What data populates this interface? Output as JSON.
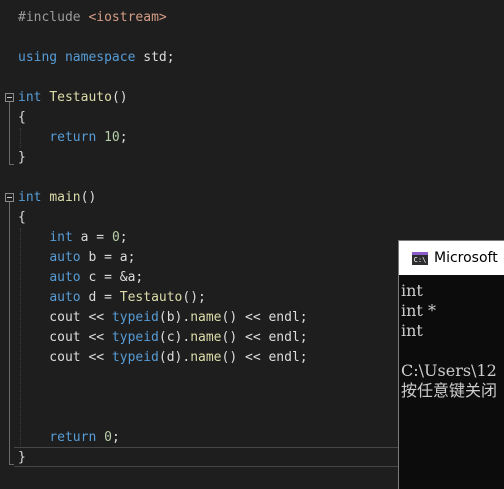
{
  "editor": {
    "lines": [
      {
        "id": "include",
        "parts": [
          [
            "kw-inc",
            "#include "
          ],
          [
            "str",
            "<iostream>"
          ]
        ]
      },
      {
        "id": "blank1",
        "parts": []
      },
      {
        "id": "using",
        "parts": [
          [
            "kw-blue",
            "using"
          ],
          [
            "ident",
            " "
          ],
          [
            "kw-blue",
            "namespace"
          ],
          [
            "ident",
            " std;"
          ]
        ]
      },
      {
        "id": "blank2",
        "parts": []
      },
      {
        "id": "testauto-decl",
        "parts": [
          [
            "kw-blue",
            "int"
          ],
          [
            "ident",
            " "
          ],
          [
            "func",
            "Testauto"
          ],
          [
            "ident",
            "()"
          ]
        ]
      },
      {
        "id": "testauto-open",
        "parts": [
          [
            "ident",
            "{"
          ]
        ]
      },
      {
        "id": "return10",
        "parts": [
          [
            "ident",
            "    "
          ],
          [
            "kw-blue",
            "return"
          ],
          [
            "ident",
            " "
          ],
          [
            "num",
            "10"
          ],
          [
            "ident",
            ";"
          ]
        ]
      },
      {
        "id": "testauto-close",
        "parts": [
          [
            "ident",
            "}"
          ]
        ]
      },
      {
        "id": "blank3",
        "parts": []
      },
      {
        "id": "main-decl",
        "parts": [
          [
            "kw-blue",
            "int"
          ],
          [
            "ident",
            " "
          ],
          [
            "func",
            "main"
          ],
          [
            "ident",
            "()"
          ]
        ]
      },
      {
        "id": "main-open",
        "parts": [
          [
            "ident",
            "{"
          ]
        ]
      },
      {
        "id": "int-a",
        "parts": [
          [
            "ident",
            "    "
          ],
          [
            "kw-blue",
            "int"
          ],
          [
            "ident",
            " a = "
          ],
          [
            "num",
            "0"
          ],
          [
            "ident",
            ";"
          ]
        ]
      },
      {
        "id": "auto-b",
        "parts": [
          [
            "ident",
            "    "
          ],
          [
            "kw-blue",
            "auto"
          ],
          [
            "ident",
            " b = a;"
          ]
        ]
      },
      {
        "id": "auto-c",
        "parts": [
          [
            "ident",
            "    "
          ],
          [
            "kw-blue",
            "auto"
          ],
          [
            "ident",
            " c = &a;"
          ]
        ]
      },
      {
        "id": "auto-d",
        "parts": [
          [
            "ident",
            "    "
          ],
          [
            "kw-blue",
            "auto"
          ],
          [
            "ident",
            " d = "
          ],
          [
            "func",
            "Testauto"
          ],
          [
            "ident",
            "();"
          ]
        ]
      },
      {
        "id": "cout-b",
        "parts": [
          [
            "ident",
            "    cout << "
          ],
          [
            "kw-blue",
            "typeid"
          ],
          [
            "ident",
            "(b)."
          ],
          [
            "func",
            "name"
          ],
          [
            "ident",
            "() << endl;"
          ]
        ]
      },
      {
        "id": "cout-c",
        "parts": [
          [
            "ident",
            "    cout << "
          ],
          [
            "kw-blue",
            "typeid"
          ],
          [
            "ident",
            "(c)."
          ],
          [
            "func",
            "name"
          ],
          [
            "ident",
            "() << endl;"
          ]
        ]
      },
      {
        "id": "cout-d",
        "parts": [
          [
            "ident",
            "    cout << "
          ],
          [
            "kw-blue",
            "typeid"
          ],
          [
            "ident",
            "(d)."
          ],
          [
            "func",
            "name"
          ],
          [
            "ident",
            "() << endl;"
          ]
        ]
      },
      {
        "id": "blank4",
        "parts": []
      },
      {
        "id": "blank5",
        "parts": []
      },
      {
        "id": "blank6",
        "parts": []
      },
      {
        "id": "return0",
        "parts": [
          [
            "ident",
            "    "
          ],
          [
            "kw-blue",
            "return"
          ],
          [
            "ident",
            " "
          ],
          [
            "num",
            "0"
          ],
          [
            "ident",
            ";"
          ]
        ]
      },
      {
        "id": "main-close",
        "parts": [
          [
            "ident",
            "}"
          ]
        ]
      }
    ]
  },
  "console": {
    "title": "Microsoft",
    "icon_label": "C:\\",
    "icon": "console-app-icon",
    "output": [
      "int",
      "int *",
      "int",
      "",
      "C:\\Users\\12",
      "按任意键关闭"
    ]
  },
  "colors": {
    "background": "#1e1e1e",
    "keyword": "#569cd6",
    "function": "#dcdcaa",
    "number": "#b5cea8",
    "string": "#d69d85",
    "console_bg": "#0c0c0c"
  }
}
